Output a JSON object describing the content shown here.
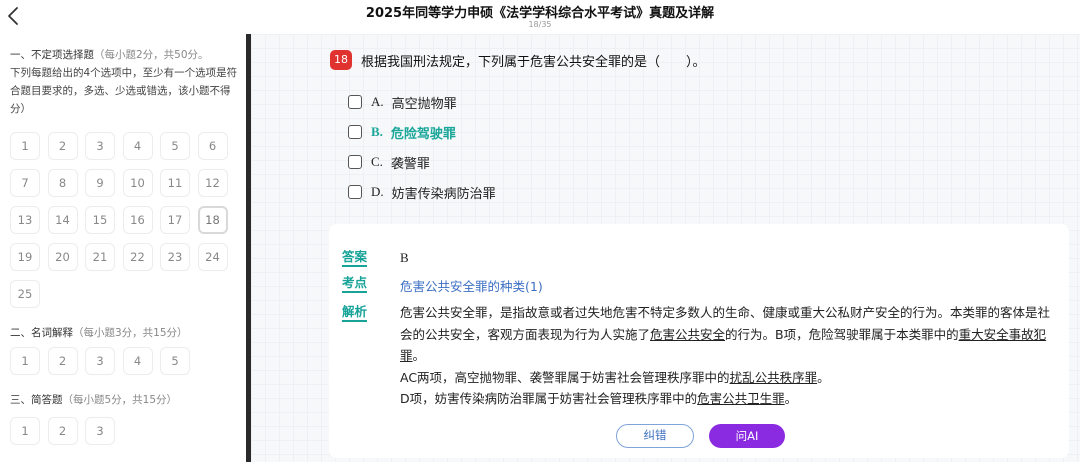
{
  "header": {
    "title": "2025年同等学力申硕《法学学科综合水平考试》真题及详解",
    "progress": "18/35"
  },
  "sidebar": {
    "section1": {
      "title": "一、不定项选择题",
      "hint": "（每小题2分，共50分。",
      "instructions": "下列每题给出的4个选项中，至少有一个选项是符合题目要求的，多选、少选或错选，该小题不得分）",
      "numbers": [
        "1",
        "2",
        "3",
        "4",
        "5",
        "6",
        "7",
        "8",
        "9",
        "10",
        "11",
        "12",
        "13",
        "14",
        "15",
        "16",
        "17",
        "18",
        "19",
        "20",
        "21",
        "22",
        "23",
        "24",
        "25"
      ],
      "current": "18"
    },
    "section2": {
      "title": "二、名词解释",
      "hint": "（每小题3分，共15分）",
      "numbers": [
        "1",
        "2",
        "3",
        "4",
        "5"
      ]
    },
    "section3": {
      "title": "三、简答题",
      "hint": "（每小题5分，共15分）",
      "numbers": [
        "1",
        "2",
        "3"
      ]
    }
  },
  "question": {
    "number": "18",
    "text": "根据我国刑法规定，下列属于危害公共安全罪的是（　　）。",
    "options": [
      {
        "letter": "A.",
        "text": "高空抛物罪",
        "correct": false
      },
      {
        "letter": "B.",
        "text": "危险驾驶罪",
        "correct": true
      },
      {
        "letter": "C.",
        "text": "袭警罪",
        "correct": false
      },
      {
        "letter": "D.",
        "text": "妨害传染病防治罪",
        "correct": false
      }
    ]
  },
  "answer": {
    "answer_label": "答案",
    "answer_value": "B",
    "kp_label": "考点",
    "kp_value": "危害公共安全罪的种类(1)",
    "analysis_label": "解析",
    "analysis": {
      "p1_a": "危害公共安全罪，是指故意或者过失地危害不特定多数人的生命、健康或重大公私财产安全的行为。本类罪的客体是社会的公共安全，客观方面表现为行为人实施了",
      "p1_u1": "危害公共安全",
      "p1_b": "的行为。B项，危险驾驶罪属于本类罪中的",
      "p1_u2": "重大安全事故犯罪",
      "p1_c": "。",
      "p2_a": "AC两项，高空抛物罪、袭警罪属于妨害社会管理秩序罪中的",
      "p2_u": "扰乱公共秩序罪",
      "p2_b": "。",
      "p3_a": "D项，妨害传染病防治罪属于妨害社会管理秩序罪中的",
      "p3_u": "危害公共卫生罪",
      "p3_b": "。"
    },
    "btn_correct": "纠错",
    "btn_ai": "问AI"
  },
  "colors": {
    "accent_teal": "#17a398",
    "badge_red": "#e0322f",
    "ai_purple": "#8a2be2",
    "link_blue": "#3b6fc4"
  }
}
